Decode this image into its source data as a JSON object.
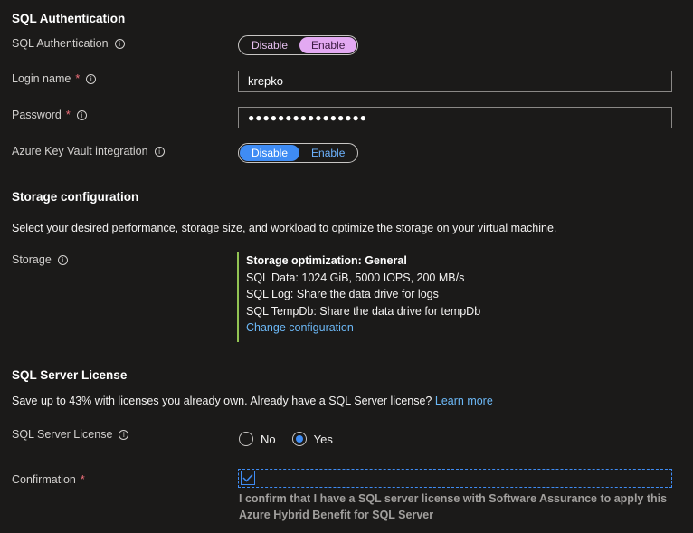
{
  "sql_auth": {
    "heading": "SQL Authentication",
    "label": "SQL Authentication",
    "toggle": {
      "disable": "Disable",
      "enable": "Enable",
      "selected": "Enable"
    },
    "login_label": "Login name",
    "login_value": "krepko",
    "password_label": "Password",
    "password_value": "●●●●●●●●●●●●●●●●",
    "akv_label": "Azure Key Vault integration",
    "akv_toggle": {
      "disable": "Disable",
      "enable": "Enable",
      "selected": "Disable"
    }
  },
  "storage": {
    "heading": "Storage configuration",
    "description": "Select your desired performance, storage size, and workload to optimize the storage on your virtual machine.",
    "label": "Storage",
    "title": "Storage optimization: General",
    "lines": [
      "SQL Data: 1024 GiB, 5000 IOPS, 200 MB/s",
      "SQL Log: Share the data drive for logs",
      "SQL TempDb: Share the data drive for tempDb"
    ],
    "change_link": "Change configuration"
  },
  "license": {
    "heading": "SQL Server License",
    "description": "Save up to 43% with licenses you already own. Already have a SQL Server license?",
    "learn_more": "Learn more",
    "label": "SQL Server License",
    "option_no": "No",
    "option_yes": "Yes",
    "selected": "Yes",
    "confirmation_label": "Confirmation",
    "confirmation_checked": true,
    "confirmation_note_line1": "I confirm that I have a SQL server license with Software Assurance to apply this",
    "confirmation_note_line2": "Azure Hybrid Benefit for SQL Server"
  },
  "required_mark": "*",
  "info_glyph": "i",
  "colors": {
    "accent": "#3f8cf4",
    "pink_selected": "#e3a9f2",
    "green_bar": "#92c353",
    "link": "#6cb8f6"
  }
}
